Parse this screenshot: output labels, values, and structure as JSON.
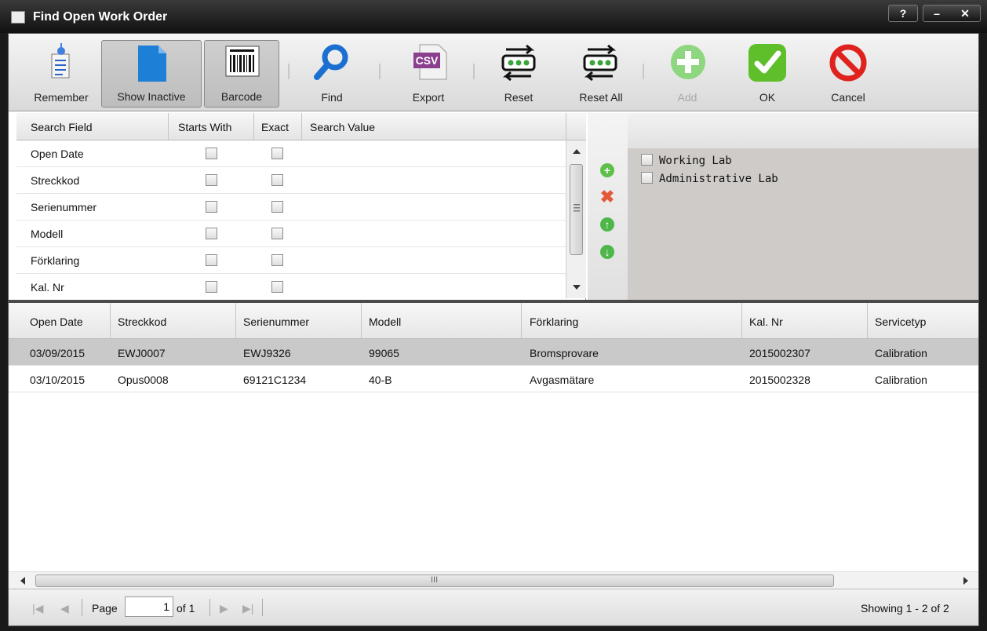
{
  "window": {
    "title": "Find Open Work Order",
    "help": "?",
    "minimize": "–",
    "close": "✕"
  },
  "toolbar": {
    "remember": "Remember",
    "show_inactive": "Show Inactive",
    "barcode": "Barcode",
    "find": "Find",
    "export": "Export",
    "export_icon_text": "CSV",
    "reset": "Reset",
    "reset_all": "Reset All",
    "add": "Add",
    "ok": "OK",
    "cancel": "Cancel"
  },
  "search": {
    "headers": {
      "field": "Search Field",
      "starts_with": "Starts With",
      "exact": "Exact",
      "value": "Search Value"
    },
    "rows": [
      {
        "field": "Open Date"
      },
      {
        "field": "Streckkod"
      },
      {
        "field": "Serienummer"
      },
      {
        "field": "Modell"
      },
      {
        "field": "Förklaring"
      },
      {
        "field": "Kal. Nr"
      }
    ]
  },
  "labs": [
    "Working Lab",
    "Administrative Lab"
  ],
  "results": {
    "headers": [
      "Open Date",
      "Streckkod",
      "Serienummer",
      "Modell",
      "Förklaring",
      "Kal. Nr",
      "Servicetyp"
    ],
    "rows": [
      [
        "03/09/2015",
        "EWJ0007",
        "EWJ9326",
        "99065",
        "Bromsprovare",
        "2015002307",
        "Calibration"
      ],
      [
        "03/10/2015",
        "Opus0008",
        "69121C1234",
        "40-B",
        "Avgasmätare",
        "2015002328",
        "Calibration"
      ]
    ],
    "scroll_grip": "III"
  },
  "pager": {
    "page_label": "Page",
    "page_value": "1",
    "of_label": "of 1",
    "showing": "Showing 1 - 2 of 2"
  },
  "colors": {
    "title_bg": "#111111",
    "selected_row": "#c9c9c9",
    "ok_green": "#5fbf2a",
    "cancel_red": "#e0221e",
    "find_blue": "#1a6fd0"
  }
}
